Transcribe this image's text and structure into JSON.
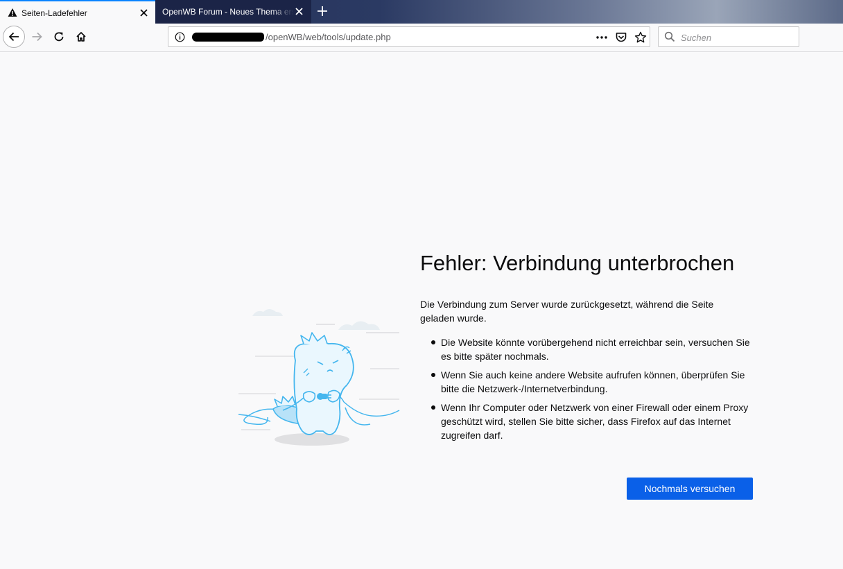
{
  "tabs": [
    {
      "title": "Seiten-Ladefehler",
      "active": true
    },
    {
      "title": "OpenWB Forum - Neues Thema erstellen",
      "active": false
    }
  ],
  "navbar": {
    "url_path": "/openWB/web/tools/update.php",
    "search_placeholder": "Suchen"
  },
  "error": {
    "title": "Fehler: Verbindung unterbrochen",
    "description": "Die Verbindung zum Server wurde zurückgesetzt, während die Seite geladen wurde.",
    "bullets": [
      "Die Website könnte vorübergehend nicht erreichbar sein, versuchen Sie es bitte später nochmals.",
      "Wenn Sie auch keine andere Website aufrufen können, überprüfen Sie bitte die Netzwerk-/Internetverbindung.",
      "Wenn Ihr Computer oder Netzwerk von einer Firewall oder einem Proxy geschützt wird, stellen Sie bitte sicher, dass Firefox auf das Internet zugreifen darf."
    ],
    "retry_label": "Nochmals versuchen"
  },
  "colors": {
    "accent": "#0a84ff",
    "button": "#0a60e8",
    "illustration": "#45b6ee"
  }
}
